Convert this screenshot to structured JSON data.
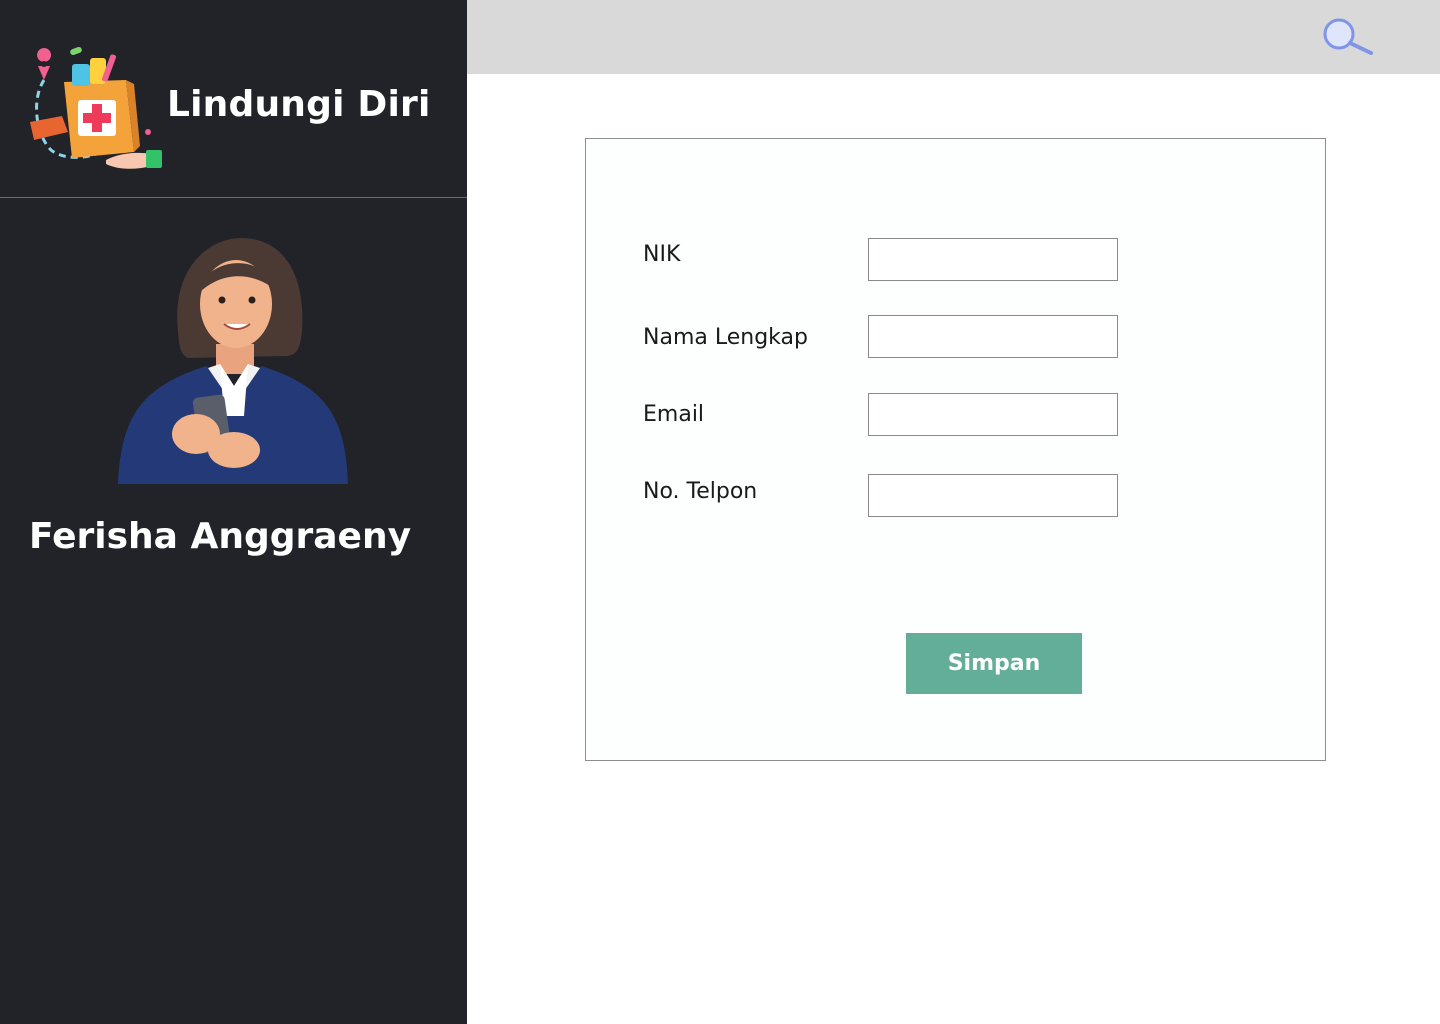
{
  "brand": {
    "title": "Lindungi Diri"
  },
  "user": {
    "name": "Ferisha Anggraeny"
  },
  "form": {
    "fields": [
      {
        "label": "NIK",
        "value": ""
      },
      {
        "label": "Nama Lengkap",
        "value": ""
      },
      {
        "label": "Email",
        "value": ""
      },
      {
        "label": "No. Telpon",
        "value": ""
      }
    ],
    "submit_label": "Simpan"
  },
  "icons": {
    "search": "search-icon",
    "logo": "medicine-bag-icon",
    "avatar": "user-avatar"
  },
  "colors": {
    "sidebar_bg": "#212329",
    "topbar_bg": "#d9d9d9",
    "accent": "#62ae99",
    "search_icon": "#7f95e6"
  }
}
